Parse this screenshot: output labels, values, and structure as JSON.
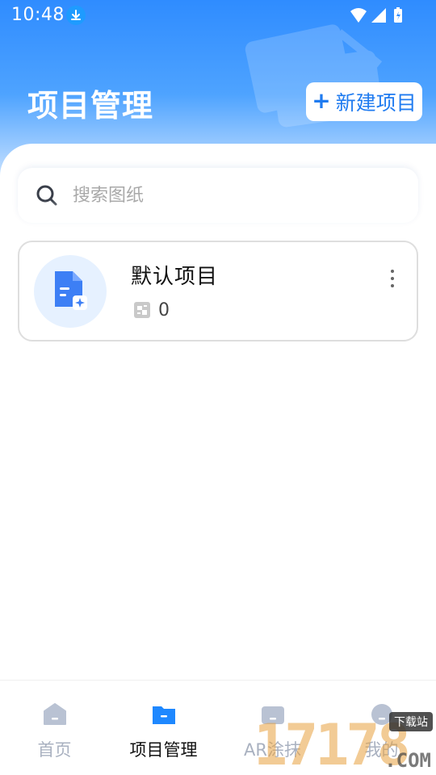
{
  "status_bar": {
    "time": "10:48"
  },
  "header": {
    "title": "项目管理",
    "new_project_label": "新建项目",
    "plus_symbol": "+"
  },
  "search": {
    "placeholder": "搜索图纸"
  },
  "projects": [
    {
      "name": "默认项目",
      "drawing_count": "0"
    }
  ],
  "bottom_nav": {
    "items": [
      {
        "label": "首页",
        "icon": "home-icon",
        "active": false
      },
      {
        "label": "项目管理",
        "icon": "folder-icon",
        "active": true
      },
      {
        "label": "AR涂抹",
        "icon": "ar-icon",
        "active": false
      },
      {
        "label": "我的",
        "icon": "profile-icon",
        "active": false
      }
    ]
  },
  "watermark": {
    "digits": "17178",
    "badge": "下载站",
    "suffix": ".COM"
  },
  "colors": {
    "brand_blue": "#1f7bf0",
    "active_nav": "#1e88ff",
    "inactive_nav": "#a9b1c0"
  }
}
